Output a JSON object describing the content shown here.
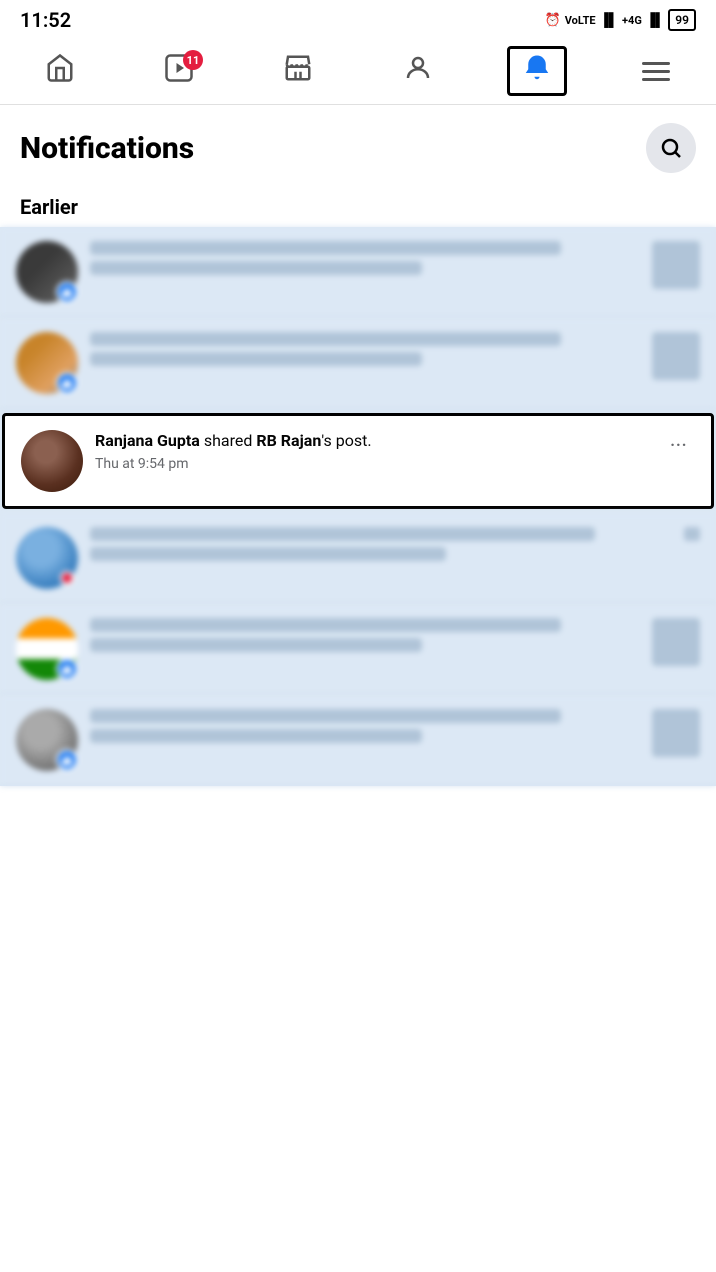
{
  "statusBar": {
    "time": "11:52",
    "battery": "99",
    "signal": "4G"
  },
  "nav": {
    "items": [
      {
        "id": "home",
        "label": "Home",
        "icon": "🏠",
        "active": false
      },
      {
        "id": "reels",
        "label": "Reels",
        "icon": "▶",
        "active": false,
        "badge": "11"
      },
      {
        "id": "marketplace",
        "label": "Marketplace",
        "icon": "🏪",
        "active": false
      },
      {
        "id": "profile",
        "label": "Profile",
        "icon": "👤",
        "active": false
      },
      {
        "id": "notifications",
        "label": "Notifications",
        "icon": "🔔",
        "active": true
      },
      {
        "id": "menu",
        "label": "Menu",
        "icon": "☰",
        "active": false
      }
    ]
  },
  "page": {
    "title": "Notifications",
    "searchLabel": "Search"
  },
  "sections": [
    {
      "label": "Earlier",
      "notifications": [
        {
          "id": "notif-1",
          "blurred": true,
          "focused": false,
          "avatarType": "dark",
          "reactionType": "like",
          "text": "",
          "time": ""
        },
        {
          "id": "notif-2",
          "blurred": true,
          "focused": false,
          "avatarType": "warm",
          "reactionType": "like",
          "text": "",
          "time": ""
        },
        {
          "id": "notif-3",
          "blurred": false,
          "focused": true,
          "avatarType": "ranjana",
          "reactionType": "none",
          "authorBold": "Ranjana Gupta",
          "actionText": " shared ",
          "targetBold": "RB Rajan",
          "suffixText": "'s post.",
          "time": "Thu at 9:54 pm"
        },
        {
          "id": "notif-4",
          "blurred": true,
          "focused": false,
          "avatarType": "blue",
          "reactionType": "red-dot",
          "text": "",
          "time": ""
        },
        {
          "id": "notif-5",
          "blurred": true,
          "focused": false,
          "avatarType": "flag",
          "reactionType": "like",
          "text": "",
          "time": ""
        },
        {
          "id": "notif-6",
          "blurred": true,
          "focused": false,
          "avatarType": "blurred5",
          "reactionType": "like",
          "text": "",
          "time": ""
        }
      ]
    }
  ],
  "icons": {
    "search": "🔍",
    "more": "•••",
    "bell": "🔔",
    "like": "👍"
  }
}
